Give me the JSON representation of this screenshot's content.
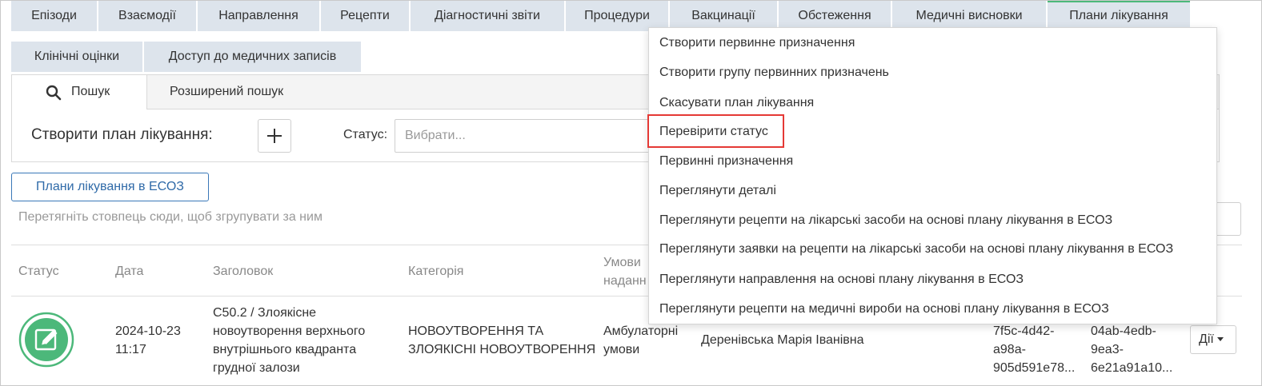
{
  "tabs_row1": [
    "Епізоди",
    "Взаємодії",
    "Направлення",
    "Рецепти",
    "Діагностичні звіти",
    "Процедури",
    "Вакцинації",
    "Обстеження",
    "Медичні висновки",
    "Плани лікування"
  ],
  "tabs_row2": [
    "Клінічні оцінки",
    "Доступ до медичних записів"
  ],
  "search": {
    "tab_search": "Пошук",
    "tab_advanced": "Розширений пошук",
    "create_label": "Створити план лікування:",
    "plus": "+",
    "status_label": "Статус:",
    "status_placeholder": "Вибрати..."
  },
  "ehealth_button": "Плани лікування в ЕСОЗ",
  "group_hint": "Перетягніть стовпець сюди, щоб згрупувати за ним",
  "table": {
    "headers": {
      "status": "Статус",
      "date": "Дата",
      "title": "Заголовок",
      "category": "Категорія",
      "conditions_l1": "Умови",
      "conditions_l2": "наданн"
    },
    "row": {
      "date_l1": "2024-10-23",
      "date_l2": "11:17",
      "title_l1": "C50.2 / Злоякісне",
      "title_l2": "новоутворення верхнього",
      "title_l3": "внутрішнього квадранта",
      "title_l4": "грудної залози",
      "category_l1": "НОВОУТВОРЕННЯ ТА",
      "category_l2": "ЗЛОЯКІСНІ НОВОУТВОРЕННЯ",
      "conditions_l1": "Амбулаторні",
      "conditions_l2": "умови",
      "doctor": "Деренівська Марія Іванівна",
      "id1_l1": "7f5c-4d42-",
      "id1_l2": "a98a-",
      "id1_l3": "905d591e78...",
      "id2_l1": "04ab-4edb-",
      "id2_l2": "9ea3-",
      "id2_l3": "6e21a91a10...",
      "actions": "Дії"
    }
  },
  "menu": [
    "Створити первинне призначення",
    "Створити групу первинних призначень",
    "Скасувати план лікування",
    "Перевірити статус",
    "Первинні призначення",
    "Переглянути деталі",
    "Переглянути рецепти на лікарські засоби на основі плану лікування в ЕСОЗ",
    "Переглянути заявки на рецепти на лікарські засоби на основі плану лікування в ЕСОЗ",
    "Переглянути направлення на основі плану лікування в ЕСОЗ",
    "Переглянути рецепти на медичні вироби на основі плану лікування в ЕСОЗ"
  ],
  "colors": {
    "accent_green": "#4cb87a",
    "highlight_red": "#e53935",
    "link_blue": "#2f6aa8",
    "tab_bg": "#dde4ec"
  }
}
